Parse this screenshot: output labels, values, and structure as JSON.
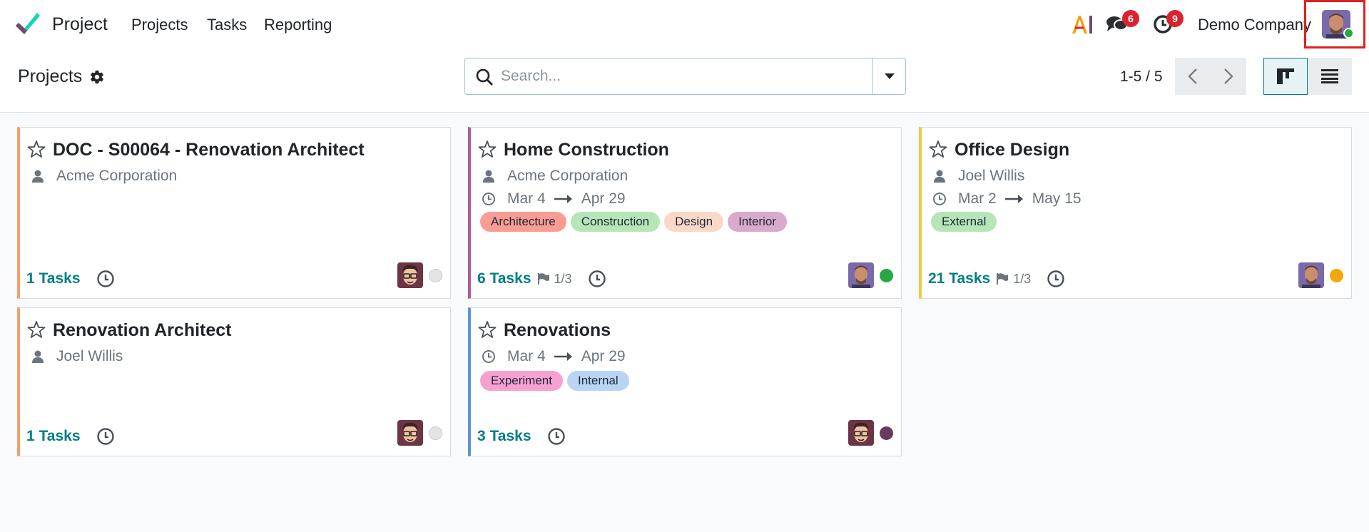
{
  "navbar": {
    "app_name": "Project",
    "menu": [
      "Projects",
      "Tasks",
      "Reporting"
    ],
    "messages_count": "6",
    "activities_count": "9",
    "company": "Demo Company",
    "ai_label": "AI"
  },
  "control": {
    "breadcrumb": "Projects",
    "search_placeholder": "Search...",
    "pager": "1-5 / 5"
  },
  "cards": [
    {
      "title": "DOC - S00064 - Renovation Architect",
      "partner": "Acme Corporation",
      "tasks": "1 Tasks",
      "color": "#f0a070",
      "status": "#e2e4e6"
    },
    {
      "title": "Home Construction",
      "partner": "Acme Corporation",
      "date_start": "Mar 4",
      "date_end": "Apr 29",
      "tags": [
        {
          "label": "Architecture",
          "bg": "#f99d94"
        },
        {
          "label": "Construction",
          "bg": "#b6e6b8"
        },
        {
          "label": "Design",
          "bg": "#f9d8c8"
        },
        {
          "label": "Interior",
          "bg": "#d9aacb"
        }
      ],
      "tasks": "6 Tasks",
      "milestones": "1/3",
      "color": "#b05b96",
      "status": "#28a745"
    },
    {
      "title": "Office Design",
      "partner": "Joel Willis",
      "date_start": "Mar 2",
      "date_end": "May 15",
      "tags": [
        {
          "label": "External",
          "bg": "#b6e6b8"
        }
      ],
      "tasks": "21 Tasks",
      "milestones": "1/3",
      "color": "#f3c940",
      "status": "#f3a70b"
    },
    {
      "title": "Renovation Architect",
      "partner": "Joel Willis",
      "tasks": "1 Tasks",
      "color": "#f0a070",
      "status": "#e2e4e6"
    },
    {
      "title": "Renovations",
      "date_start": "Mar 4",
      "date_end": "Apr 29",
      "tags": [
        {
          "label": "Experiment",
          "bg": "#f7a1d3"
        },
        {
          "label": "Internal",
          "bg": "#b9d5f3"
        }
      ],
      "tasks": "3 Tasks",
      "color": "#5c95d6",
      "status": "#6a3a5c"
    }
  ]
}
